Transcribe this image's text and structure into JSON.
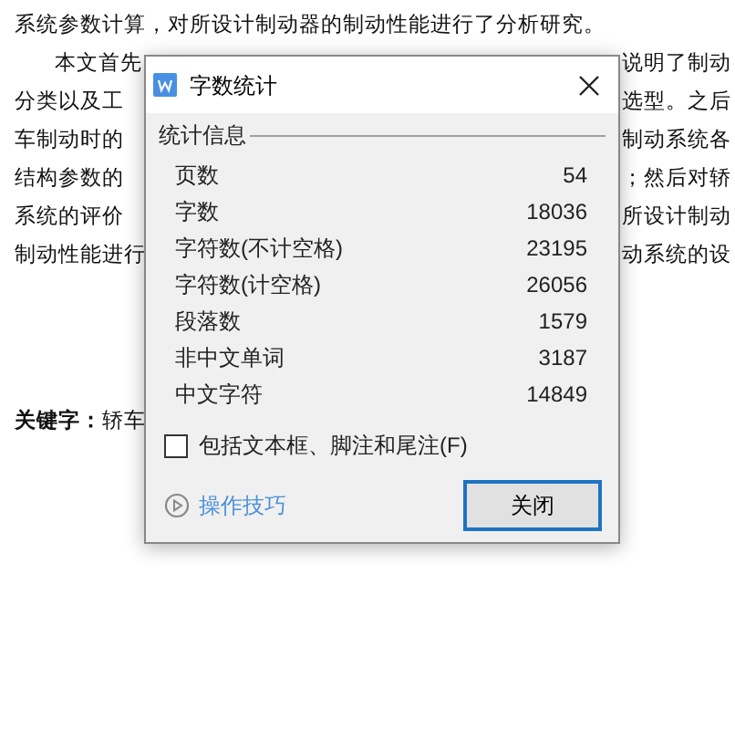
{
  "document": {
    "lines": [
      {
        "left": "系统参数计算，对所设计制动器的制动性能进行了分析研究。",
        "indent": false
      },
      {
        "left": "本文首先",
        "right": "说明了制动",
        "indent": true
      },
      {
        "left": "分类以及工",
        "right": "选型。之后",
        "indent": false
      },
      {
        "left": "车制动时的",
        "right": "制动系统各",
        "indent": false
      },
      {
        "left": "结构参数的",
        "right": "；然后对轿",
        "indent": false
      },
      {
        "left": "系统的评价",
        "right": "所设计制动",
        "indent": false
      },
      {
        "left": "制动性能进行",
        "right": "动系统的设",
        "indent": false
      }
    ],
    "keywords": "**关键字：**轿车"
  },
  "dialog": {
    "title": "字数统计",
    "section": "统计信息",
    "stats": [
      {
        "label": "页数",
        "value": "54"
      },
      {
        "label": "字数",
        "value": "18036"
      },
      {
        "label": "字符数(不计空格)",
        "value": "23195"
      },
      {
        "label": "字符数(计空格)",
        "value": "26056"
      },
      {
        "label": "段落数",
        "value": "1579"
      },
      {
        "label": "非中文单词",
        "value": "3187"
      },
      {
        "label": "中文字符",
        "value": "14849"
      }
    ],
    "include_checkbox": {
      "label": "包括文本框、脚注和尾注(F)",
      "checked": false
    },
    "tips_link": "操作技巧",
    "close_button": "关闭"
  }
}
